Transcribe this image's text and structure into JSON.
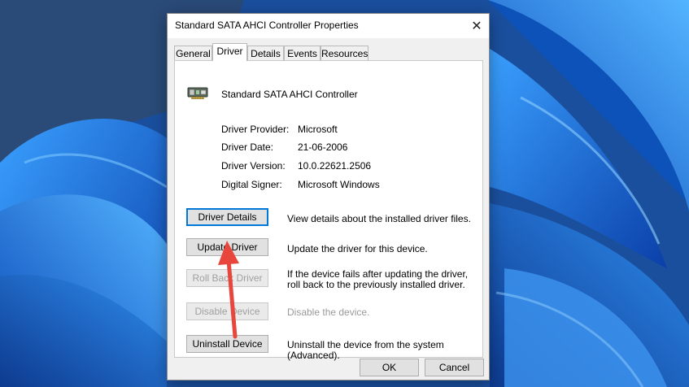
{
  "window": {
    "title": "Standard SATA AHCI Controller Properties",
    "close_glyph": "✕"
  },
  "tabs": [
    {
      "label": "General"
    },
    {
      "label": "Driver",
      "active": true
    },
    {
      "label": "Details"
    },
    {
      "label": "Events"
    },
    {
      "label": "Resources"
    }
  ],
  "device": {
    "name": "Standard SATA AHCI Controller",
    "icon": "storage-controller-icon"
  },
  "driver_info": [
    {
      "label": "Driver Provider:",
      "value": "Microsoft"
    },
    {
      "label": "Driver Date:",
      "value": "21-06-2006"
    },
    {
      "label": "Driver Version:",
      "value": "10.0.22621.2506"
    },
    {
      "label": "Digital Signer:",
      "value": "Microsoft Windows"
    }
  ],
  "actions": [
    {
      "label": "Driver Details",
      "description": "View details about the installed driver files.",
      "enabled": true
    },
    {
      "label": "Update Driver",
      "description": "Update the driver for this device.",
      "enabled": true
    },
    {
      "label": "Roll Back Driver",
      "description": "If the device fails after updating the driver, roll back to the previously installed driver.",
      "enabled": false
    },
    {
      "label": "Disable Device",
      "description": "Disable the device.",
      "enabled": false
    },
    {
      "label": "Uninstall Device",
      "description": "Uninstall the device from the system (Advanced).",
      "enabled": true
    }
  ],
  "footer": {
    "ok_label": "OK",
    "cancel_label": "Cancel"
  },
  "annotation": {
    "arrow_color": "#e8463c",
    "points_to": "Update Driver"
  }
}
